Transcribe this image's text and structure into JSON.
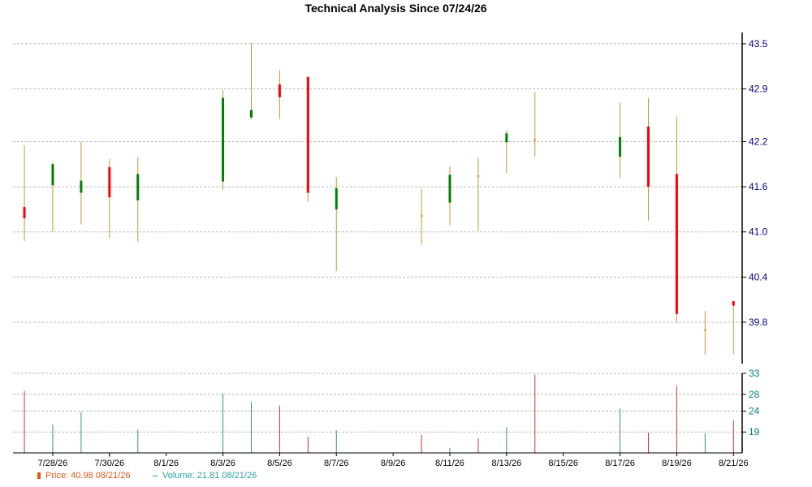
{
  "chart_data": {
    "type": "candlestick",
    "title": "Technical Analysis Since 07/24/26",
    "price_axis": {
      "ylim": [
        39.25,
        43.65
      ],
      "ticks": [
        "43.5",
        "42.9",
        "42.2",
        "41.6",
        "41.0",
        "40.4",
        "39.8"
      ],
      "tick_values": [
        43.5,
        42.9,
        42.2,
        41.6,
        41.0,
        40.4,
        39.8
      ]
    },
    "volume_axis": {
      "ylim": [
        14,
        33
      ],
      "ticks": [
        "33",
        "28",
        "24",
        "19"
      ],
      "tick_values": [
        33,
        28,
        24,
        19
      ]
    },
    "x_range": [
      0,
      26
    ],
    "x_ticks": [
      {
        "label": "7/28/26",
        "day": 4
      },
      {
        "label": "7/30/26",
        "day": 6
      },
      {
        "label": "8/1/26",
        "day": 8
      },
      {
        "label": "8/3/26",
        "day": 10
      },
      {
        "label": "8/5/26",
        "day": 12
      },
      {
        "label": "8/7/26",
        "day": 14
      },
      {
        "label": "8/9/26",
        "day": 16
      },
      {
        "label": "8/11/26",
        "day": 18
      },
      {
        "label": "8/13/26",
        "day": 20
      },
      {
        "label": "8/15/26",
        "day": 22
      },
      {
        "label": "8/17/26",
        "day": 24
      },
      {
        "label": "8/19/26",
        "day": 26
      },
      {
        "label": "8/21/26",
        "day": 28
      }
    ],
    "candles": [
      {
        "date": "7/27/26",
        "day": 3,
        "open": 41.33,
        "high": 42.15,
        "low": 40.88,
        "close": 41.18,
        "volume": 28.8
      },
      {
        "date": "7/28/26",
        "day": 4,
        "open": 41.62,
        "high": 41.93,
        "low": 41.0,
        "close": 41.9,
        "volume": 20.8
      },
      {
        "date": "7/29/26",
        "day": 5,
        "open": 41.52,
        "high": 42.2,
        "low": 41.1,
        "close": 41.68,
        "volume": 23.8
      },
      {
        "date": "7/30/26",
        "day": 6,
        "open": 41.86,
        "high": 41.97,
        "low": 40.91,
        "close": 41.46,
        "volume": 13.0
      },
      {
        "date": "7/31/26",
        "day": 7,
        "open": 41.42,
        "high": 41.99,
        "low": 40.87,
        "close": 41.77,
        "volume": 19.6
      },
      {
        "date": "8/3/26",
        "day": 10,
        "open": 41.67,
        "high": 42.88,
        "low": 41.56,
        "close": 42.78,
        "volume": 28.2
      },
      {
        "date": "8/4/26",
        "day": 11,
        "open": 42.52,
        "high": 43.51,
        "low": 42.5,
        "close": 42.62,
        "volume": 26.2
      },
      {
        "date": "8/5/26",
        "day": 12,
        "open": 42.96,
        "high": 43.15,
        "low": 42.5,
        "close": 42.79,
        "volume": 25.3
      },
      {
        "date": "8/6/26",
        "day": 13,
        "open": 43.06,
        "high": 43.06,
        "low": 41.4,
        "close": 41.52,
        "volume": 17.9
      },
      {
        "date": "8/7/26",
        "day": 14,
        "open": 41.3,
        "high": 41.73,
        "low": 40.48,
        "close": 41.58,
        "volume": 19.4
      },
      {
        "date": "8/10/26",
        "day": 17,
        "open": 41.22,
        "high": 41.57,
        "low": 40.83,
        "close": 41.21,
        "volume": 18.3
      },
      {
        "date": "8/11/26",
        "day": 18,
        "open": 41.39,
        "high": 41.87,
        "low": 41.09,
        "close": 41.76,
        "volume": 15.2
      },
      {
        "date": "8/12/26",
        "day": 19,
        "open": 41.75,
        "high": 41.98,
        "low": 41.01,
        "close": 41.74,
        "volume": 17.5
      },
      {
        "date": "8/13/26",
        "day": 20,
        "open": 42.19,
        "high": 42.35,
        "low": 41.78,
        "close": 42.31,
        "volume": 20.1
      },
      {
        "date": "8/14/26",
        "day": 21,
        "open": 42.23,
        "high": 42.86,
        "low": 42.0,
        "close": 42.22,
        "volume": 32.7
      },
      {
        "date": "8/17/26",
        "day": 24,
        "open": 42.0,
        "high": 42.72,
        "low": 41.72,
        "close": 42.26,
        "volume": 24.6
      },
      {
        "date": "8/18/26",
        "day": 25,
        "open": 42.4,
        "high": 42.78,
        "low": 41.15,
        "close": 41.6,
        "volume": 18.8
      },
      {
        "date": "8/19/26",
        "day": 26,
        "open": 41.77,
        "high": 42.53,
        "low": 39.79,
        "close": 39.91,
        "volume": 30.0
      },
      {
        "date": "8/20/26",
        "day": 27,
        "open": 39.7,
        "high": 39.95,
        "low": 39.37,
        "close": 39.7,
        "volume": 18.7
      },
      {
        "date": "8/21/26",
        "day": 28,
        "open": 40.08,
        "high": 40.08,
        "low": 39.38,
        "close": 40.02,
        "volume": 21.8
      }
    ],
    "colors": {
      "up": "#008000",
      "down": "#ff0000",
      "flat": "#c89632",
      "wick": "#c89632",
      "vol_up": "#339966",
      "vol_down": "#cc3333",
      "grid": "#bbbbbb",
      "price_tick": "#000080",
      "volume_tick": "#008080"
    },
    "grid": true
  },
  "legend": {
    "price_label": "Price: 40.98  08/21/26",
    "volume_label": "Volume: 21.81  08/21/26",
    "price_color": "#e0571a",
    "volume_color": "#2aa0a0"
  }
}
